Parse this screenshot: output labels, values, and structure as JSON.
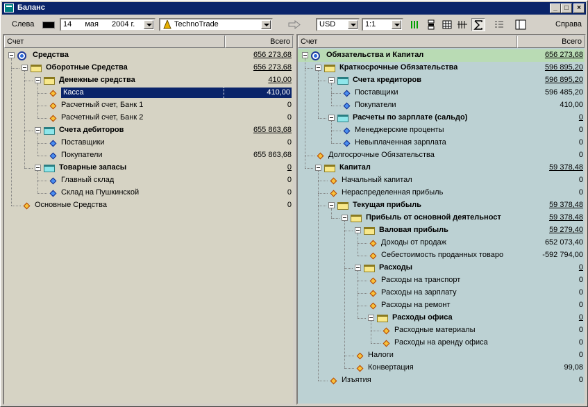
{
  "window": {
    "title": "Баланс",
    "buttons": [
      "_",
      "□",
      "×"
    ]
  },
  "toolbar": {
    "left_label": "Слева",
    "right_label": "Справа",
    "date": {
      "day": "14",
      "month": "мая",
      "year": "2004 г."
    },
    "company": "TechnoTrade",
    "currency": "USD",
    "scale": "1:1",
    "icons": [
      "arrow-right-icon",
      "columns-green-icon",
      "row-toggle-icon",
      "grid-icon",
      "split-icon",
      "sum-icon",
      "list-check-icon",
      "layout-icon"
    ]
  },
  "left_pane": {
    "col_account": "Счет",
    "col_total": "Всего",
    "rows": [
      {
        "label": "Средства",
        "value": "656 273,68"
      },
      {
        "label": "Оборотные Средства",
        "value": "656 273,68"
      },
      {
        "label": "Денежные средства",
        "value": "410,00"
      },
      {
        "label": "Касса",
        "value": "410,00"
      },
      {
        "label": "Расчетный счет, Банк 1",
        "value": "0"
      },
      {
        "label": "Расчетный счет, Банк 2",
        "value": "0"
      },
      {
        "label": "Счета дебиторов",
        "value": "655 863,68"
      },
      {
        "label": "Поставщики",
        "value": "0"
      },
      {
        "label": "Покупатели",
        "value": "655 863,68"
      },
      {
        "label": "Товарные запасы",
        "value": "0"
      },
      {
        "label": "Главный склад",
        "value": "0"
      },
      {
        "label": "Склад на Пушкинской",
        "value": "0"
      },
      {
        "label": "Основные Средства",
        "value": "0"
      }
    ]
  },
  "right_pane": {
    "col_account": "Счет",
    "col_total": "Всего",
    "rows": [
      {
        "label": "Обязательства и Капитал",
        "value": "656 273,68"
      },
      {
        "label": "Краткосрочные Обязательства",
        "value": "596 895,20"
      },
      {
        "label": "Счета кредиторов",
        "value": "596 895,20"
      },
      {
        "label": "Поставщики",
        "value": "596 485,20"
      },
      {
        "label": "Покупатели",
        "value": "410,00"
      },
      {
        "label": "Расчеты по зарплате (сальдо)",
        "value": "0"
      },
      {
        "label": "Менеджерские проценты",
        "value": "0"
      },
      {
        "label": "Невыплаченная зарплата",
        "value": "0"
      },
      {
        "label": "Долгосрочные Обязательства",
        "value": "0"
      },
      {
        "label": "Капитал",
        "value": "59 378,48"
      },
      {
        "label": "Начальный капитал",
        "value": "0"
      },
      {
        "label": "Нераспределенная прибыль",
        "value": "0"
      },
      {
        "label": "Текущая прибыль",
        "value": "59 378,48"
      },
      {
        "label": "Прибыль от основной деятельност",
        "value": "59 378,48"
      },
      {
        "label": "Валовая прибыль",
        "value": "59 279,40"
      },
      {
        "label": "Доходы от продаж",
        "value": "652 073,40"
      },
      {
        "label": "Себестоимость проданных товаро",
        "value": "-592 794,00"
      },
      {
        "label": "Расходы",
        "value": "0"
      },
      {
        "label": "Расходы на транспорт",
        "value": "0"
      },
      {
        "label": "Расходы на зарплату",
        "value": "0"
      },
      {
        "label": "Расходы на ремонт",
        "value": "0"
      },
      {
        "label": "Расходы офиса",
        "value": "0"
      },
      {
        "label": "Расходные материалы",
        "value": "0"
      },
      {
        "label": "Расходы на аренду офиса",
        "value": "0"
      },
      {
        "label": "Налоги",
        "value": "0"
      },
      {
        "label": "Конвертация",
        "value": "99,08"
      },
      {
        "label": "Изъятия",
        "value": "0"
      }
    ]
  }
}
